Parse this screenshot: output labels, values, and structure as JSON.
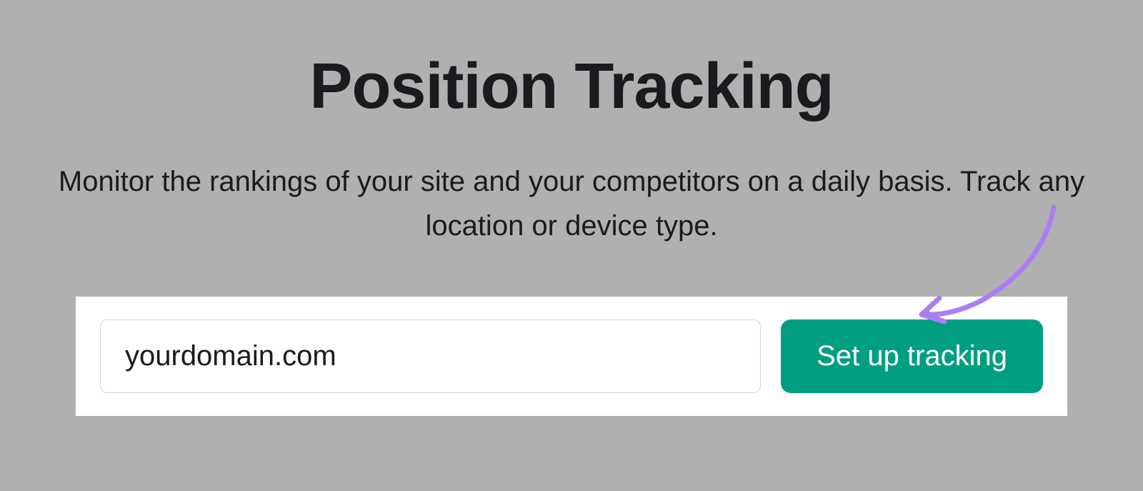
{
  "heading": {
    "title": "Position Tracking",
    "subtitle": "Monitor the rankings of your site and your competitors on a daily basis. Track any location or device type."
  },
  "form": {
    "domain_value": "yourdomain.com",
    "submit_label": "Set up tracking"
  },
  "colors": {
    "accent": "#009f81",
    "annotation": "#ab7ef6"
  }
}
